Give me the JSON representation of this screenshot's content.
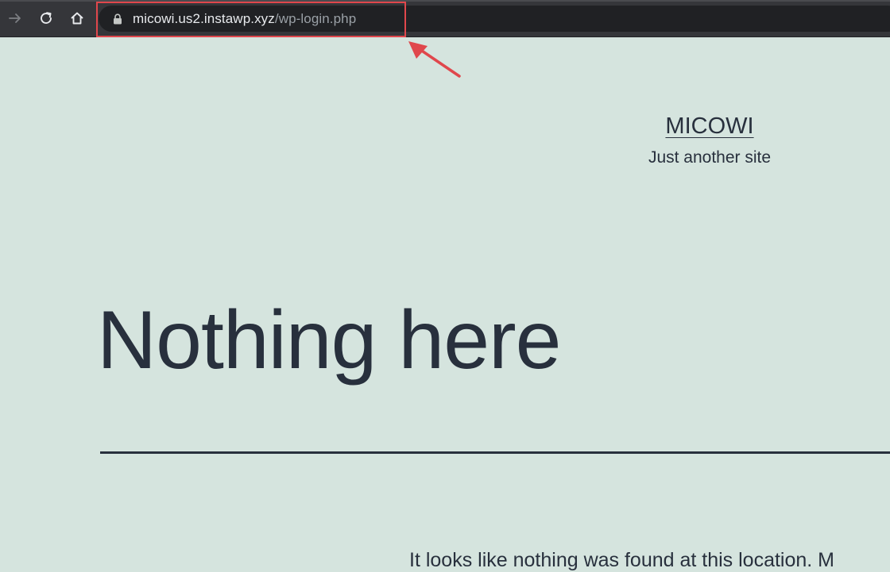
{
  "browser": {
    "url_host": "micowi.us2.instawp.xyz",
    "url_path": "/wp-login.php",
    "icons": [
      "forward-icon",
      "reload-icon",
      "home-icon",
      "lock-icon"
    ],
    "annotation_color": "#e0474c"
  },
  "site": {
    "title": "MICOWI",
    "description": "Just another site"
  },
  "main": {
    "heading": "Nothing here",
    "message": "It looks like nothing was found at this location. M"
  },
  "colors": {
    "background": "#d5e4de",
    "text": "#28303d",
    "toolbar": "#35363a"
  }
}
